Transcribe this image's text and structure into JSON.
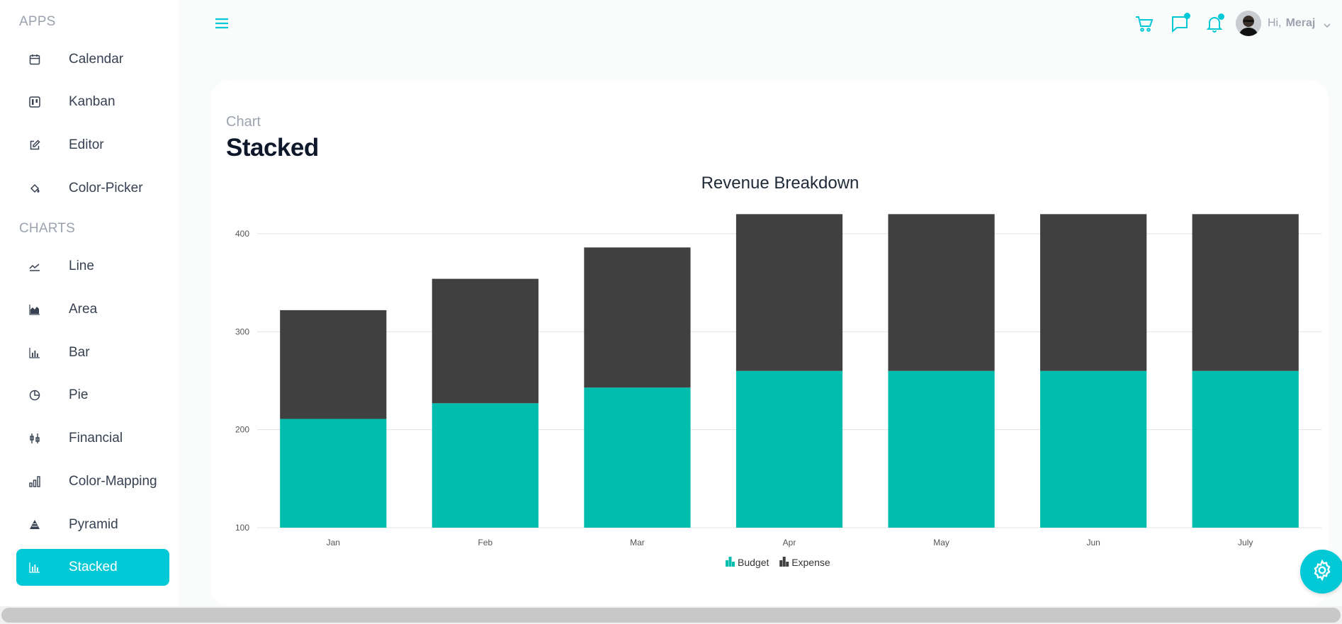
{
  "sidebar": {
    "apps_title": "APPS",
    "charts_title": "CHARTS",
    "apps": [
      {
        "label": "Calendar",
        "icon": "calendar-icon"
      },
      {
        "label": "Kanban",
        "icon": "kanban-icon"
      },
      {
        "label": "Editor",
        "icon": "edit-icon"
      },
      {
        "label": "Color-Picker",
        "icon": "paint-bucket-icon"
      }
    ],
    "charts": [
      {
        "label": "Line",
        "icon": "line-chart-icon"
      },
      {
        "label": "Area",
        "icon": "area-chart-icon"
      },
      {
        "label": "Bar",
        "icon": "bar-chart-icon"
      },
      {
        "label": "Pie",
        "icon": "pie-chart-icon"
      },
      {
        "label": "Financial",
        "icon": "financial-icon"
      },
      {
        "label": "Color-Mapping",
        "icon": "color-mapping-icon"
      },
      {
        "label": "Pyramid",
        "icon": "pyramid-icon"
      },
      {
        "label": "Stacked",
        "icon": "stacked-chart-icon",
        "active": true
      }
    ]
  },
  "navbar": {
    "greeting": "Hi,",
    "user_name": "Meraj",
    "icons": [
      "menu-icon",
      "cart-icon",
      "chat-icon",
      "bell-icon",
      "chevron-down-icon"
    ]
  },
  "page": {
    "breadcrumb": "Chart",
    "title": "Stacked"
  },
  "colors": {
    "accent": "#03c9d7",
    "budget": "#00bdae",
    "expense": "#404041"
  },
  "chart_data": {
    "type": "bar",
    "stacked": true,
    "title": "Revenue Breakdown",
    "categories": [
      "Jan",
      "Feb",
      "Mar",
      "Apr",
      "May",
      "Jun",
      "July"
    ],
    "series": [
      {
        "name": "Budget",
        "values": [
          111,
          127,
          143,
          160,
          160,
          160,
          160
        ]
      },
      {
        "name": "Expense",
        "values": [
          111,
          127,
          143,
          160,
          160,
          160,
          160
        ]
      }
    ],
    "ylim": [
      100,
      400
    ],
    "yticks": [
      100,
      200,
      300,
      400
    ],
    "grid": true,
    "legend_position": "bottom"
  }
}
